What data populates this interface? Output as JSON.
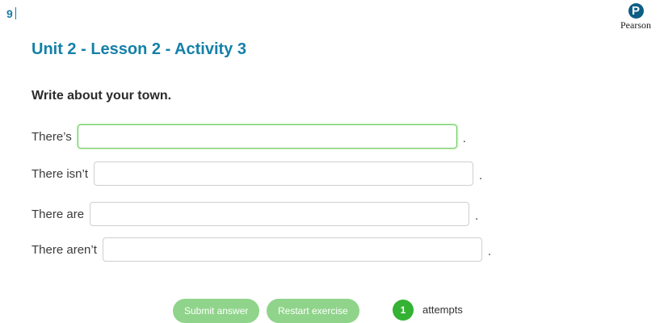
{
  "page_number": "9",
  "logo": {
    "mark": "P",
    "word": "Pearson"
  },
  "title": "Unit 2 - Lesson 2 - Activity 3",
  "instruction": "Write about your town.",
  "rows": [
    {
      "label": "There’s",
      "value": "",
      "placeholder": "",
      "end": "."
    },
    {
      "label": "There isn’t",
      "value": "",
      "placeholder": "",
      "end": "."
    },
    {
      "label": "There are",
      "value": "",
      "placeholder": "",
      "end": "."
    },
    {
      "label": "There aren’t",
      "value": "",
      "placeholder": "",
      "end": "."
    }
  ],
  "buttons": {
    "submit": "Submit answer",
    "restart": "Restart exercise"
  },
  "attempts": {
    "count": "1",
    "label": "attempts"
  },
  "colors": {
    "title": "#1580a8",
    "button": "#8fd48a",
    "badge": "#34b233",
    "focus_border": "#6ac85c"
  }
}
